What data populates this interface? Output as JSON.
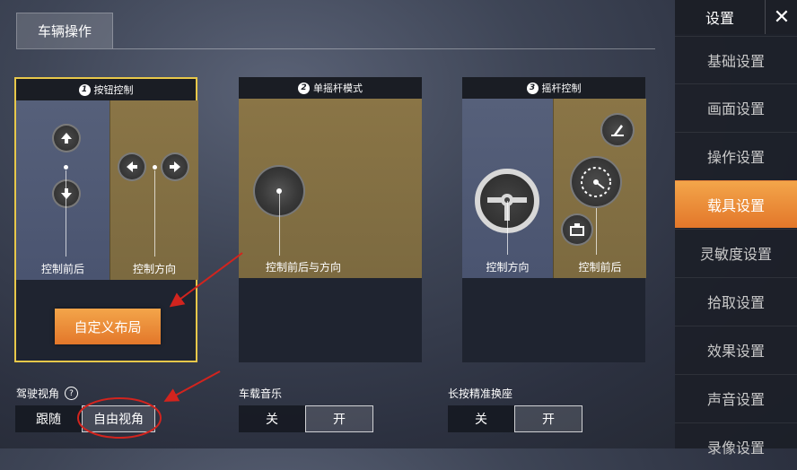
{
  "tab": {
    "label": "车辆操作"
  },
  "cards": [
    {
      "num": "1",
      "title": "按钮控制",
      "left_label": "控制前后",
      "right_label": "控制方向",
      "custom_button": "自定义布局"
    },
    {
      "num": "2",
      "title": "单摇杆模式",
      "label": "控制前后与方向"
    },
    {
      "num": "3",
      "title": "摇杆控制",
      "left_label": "控制方向",
      "right_label": "控制前后"
    }
  ],
  "options": {
    "view": {
      "label": "驾驶视角",
      "choices": [
        "跟随",
        "自由视角"
      ],
      "selected": "自由视角"
    },
    "music": {
      "label": "车载音乐",
      "choices": [
        "关",
        "开"
      ],
      "selected": "开"
    },
    "seat": {
      "label": "长按精准换座",
      "choices": [
        "关",
        "开"
      ],
      "selected": "开"
    }
  },
  "sidebar": {
    "title": "设置",
    "items": [
      "基础设置",
      "画面设置",
      "操作设置",
      "载具设置",
      "灵敏度设置",
      "拾取设置",
      "效果设置",
      "声音设置",
      "录像设置"
    ],
    "active": "载具设置"
  },
  "colors": {
    "accent": "#e3772a",
    "selected_border": "#e8c84a",
    "annotation": "#d2241e"
  }
}
